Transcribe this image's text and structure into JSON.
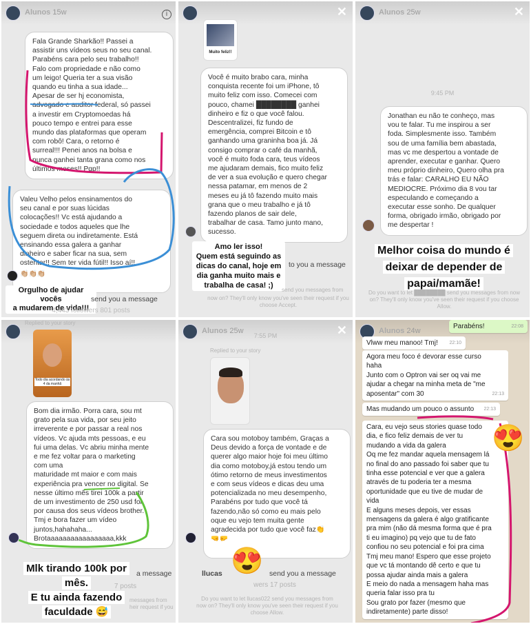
{
  "panels": {
    "p1": {
      "user": "Alunos",
      "time": "15w",
      "info_glyph": "i",
      "msg1": "Fala Grande Sharkão!! Passei a\nassistir uns vídeos seus no seu canal.\nParabéns cara pelo seu trabalho!!\nFalo com propriedade e não como\num leigo! Queria ter a sua visão\nquando eu tinha a sua idade...\nApesar de ser hj economista,\nadvogado e auditor federal, só passei\na investir em Cryptomoedas há\npouco tempo e entrei para esse\nmundo das plataformas que operam\ncom robô! Cara,  o retorno é\nsurreal!!! Penei anos na bolsa e\nnunca ganhei tanta grana como nos\núltimos meses!! Pqp!!",
      "msg2": "Valeu Velho pelos ensinamentos do\nseu canal e por suas lúcidas\ncolocações!! Vc está ajudando a\nsociedade e todos aqueles que lhe\nseguem direta ou indiretamente. Está\nensinando essa galera a ganhar\ndinheiro e saber ficar na sua, sem\nostentar!! Sem ter vida fútil!! Isso aí!!",
      "clap": "👏🏼👏🏼👏🏼",
      "caption": "Orgulho de ajudar vocês\na mudarem de vida!!!",
      "reply_tail": "send you a message",
      "stats": "4,443 followers  801 posts"
    },
    "p2": {
      "thumb_label": "Muito feliz!!",
      "msg": "Você é muito brabo cara, minha\nconquista recente foi um iPhone, tô\nmuito feliz com isso. Comecei com\npouco, chamei ████████ ganhei\ndinheiro e fiz o que você falou.\nDescentralizei, fiz fundo de\nemergência, comprei Bitcoin e tô\nganhando uma graninha boa já. Já\nconsigo comprar o café da manhã,\nvocê é muito foda cara, teus vídeos\nme ajudaram demais, fico muito feliz\nde ver a sua evolução e quero chegar\nnessa patamar, em menos de 2\nmeses eu já tô fazendo muito mais\ngrana que o meu trabalho e já tô\nfazendo planos de sair dele,\ntrabalhar de casa. Tamo junto mano,\nsucesso.",
      "caption": "Amo ler isso!\nQuem está seguindo as\ndicas do canal, hoje em\ndia ganha muito mais e\ntrabalha de casa! ;)",
      "reply_tail": "to you a message",
      "reply_tail2": "send you messages from",
      "footer": "now on? They'll only know you've seen their request if you\nchoose Accept."
    },
    "p3": {
      "user": "Alunos",
      "time": "25w",
      "timestamp": "9:45 PM",
      "msg": "Jonathan eu não te conheço, mas\nvou te falar. Tu me inspirou a ser\nfoda. Simplesmente isso. Também\nsou de uma família bem abastada,\nmas vc me despertou a vontade de\naprender, executar e ganhar. Quero\nmeu próprio dinheiro, Quero olha pra\ntrás  e falar: CARALHO EU NÃO\nMEDIOCRE. Próximo dia 8 vou tar\nespeculando e começando a\nexecutar esse sonho. De qualquer\nforma, obrigado irmão, obrigado por\nme despertar !",
      "caption": "Melhor coisa do mundo é\ndeixar de depender de\npapai/mamãe!",
      "footer": "Do you want to let ████████ send you messages from now on? They'll only know you've seen their request if you choose Allow."
    },
    "p4": {
      "replied": "Replied to your story",
      "story_label": "Todo dia acordando às\n4 da manhã",
      "msg": "Bom dia irmão. Porra cara, sou mt\ngrato pela sua vida, por seu jeito\nirreverente e por passar a real nos\nvídeos. Vc ajuda mts pessoas, e eu\nfui uma delas. Vc abriu minha mente\ne me fez voltar para o marketing\n                    com uma\nmaturidade mt maior e com mais\nexperiência pra vencer no digital. Se\nnesse último mês tirei 100k  a partir\nde um investimento de 250 usd foi\npor causa dos seus vídeos brother.\nTmj e bora fazer um vídeo\njuntos,hahahaha...\nBrotaaaaaaaaaaaaaaaaa,kkk",
      "caption_line1": "Mlk tirando 100k por",
      "caption_line2": "mês.",
      "caption_line3": "E tu ainda fazendo",
      "caption_line4": "faculdade 😅",
      "reply_tail": "a message",
      "stats": "7 posts",
      "footer": "messages from\nheir request if you"
    },
    "p5": {
      "user": "Alunos",
      "time": "25w",
      "timestamp": "7:55 PM",
      "replied": "Replied to your story",
      "msg": "Cara sou motoboy também, Graças a\nDeus devido a força de vontade e de\nquerer algo maior hoje foi meu último\ndia como motoboy,já estou tendo um\nótimo retorno de meus investimentos\ne com seus vídeos e  dicas deu uma\npotencializada no meu desempenho,\nParabéns por tudo que você tá\nfazendo,não só como eu mais pelo\noque eu vejo tem muita gente\nagradecida por tudo que você faz👏",
      "react": "🤜🤛",
      "reply_user": "llucas",
      "reply_tail": "send you a message",
      "stats": "wers  17 posts",
      "footer": "Do you want to let llucas022 send you messages from\nnow on? They'll only know you've seen their request if you\nchoose Allow.",
      "emoji": "😍"
    },
    "p6": {
      "user": "Alunos",
      "time": "24w",
      "b0": "Parabéns!",
      "b0_time": "22:08",
      "b1": "Vlww meu manoo! Tmj!",
      "b1_time": "22:10",
      "b2": "Agora meu foco é devorar esse curso\nhaha\nJunto com o Optron vai ser oq vai me\najudar a chegar na minha meta de \"me\naposentar\" com 30",
      "b2_time": "22:13",
      "b3": "Mas mudando um pouco o assunto",
      "b3_time": "22:13",
      "b4": "Cara, eu vejo seus stories quase todo\ndia, e fico feliz demais de ver tu\nmudando a vida da galera\nOq me fez mandar aquela mensagem lá\nno final do ano passado foi saber que tu\ntinha esse potencial e ver que a galera\natravés de tu poderia ter a mesma\noportunidade que eu tive de mudar de\nvida\nE alguns meses depois, ver essas\nmensagens da galera é algo gratificante\npra mim (não dá mesma forma que é pra\nti eu imagino) pq vejo que tu de fato\nconfiou no seu potencial e foi pra cima\nTmj meu mano! Espero que esse projeto\nque vc tá montando dê certo e que tu\npossa ajudar ainda mais a galera\nE meio do nada a mensagem haha mas\nqueria falar isso pra tu\nSou grato por fazer (mesmo que\nindiretamente) parte disso!",
      "emoji": "😍"
    }
  },
  "colors": {
    "highlight_pink": "#d4166e",
    "highlight_blue": "#3b8fd6",
    "highlight_green": "#5fc43a"
  }
}
